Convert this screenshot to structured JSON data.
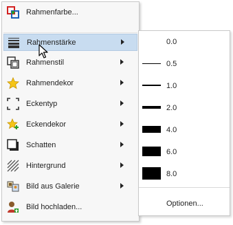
{
  "menu": {
    "items": [
      {
        "label": "Rahmenfarbe...",
        "icon": "frame-color-icon",
        "submenu": false
      },
      {
        "label": "Rahmenstärke",
        "icon": "line-weight-icon",
        "submenu": true
      },
      {
        "label": "Rahmenstil",
        "icon": "frame-style-icon",
        "submenu": true
      },
      {
        "label": "Rahmendekor",
        "icon": "star-icon",
        "submenu": true
      },
      {
        "label": "Eckentyp",
        "icon": "corner-type-icon",
        "submenu": true
      },
      {
        "label": "Eckendekor",
        "icon": "star-plus-icon",
        "submenu": true
      },
      {
        "label": "Schatten",
        "icon": "shadow-icon",
        "submenu": true
      },
      {
        "label": "Hintergrund",
        "icon": "hatch-icon",
        "submenu": true
      },
      {
        "label": "Bild aus Galerie",
        "icon": "gallery-icon",
        "submenu": true
      },
      {
        "label": "Bild hochladen...",
        "icon": "upload-user-icon",
        "submenu": false
      }
    ],
    "highlighted_index": 1
  },
  "submenu": {
    "options": [
      {
        "value": "0.0"
      },
      {
        "value": "0.5"
      },
      {
        "value": "1.0"
      },
      {
        "value": "2.0"
      },
      {
        "value": "4.0"
      },
      {
        "value": "6.0"
      },
      {
        "value": "8.0"
      }
    ],
    "footer": "Optionen..."
  },
  "colors": {
    "highlight": "#c8dcf0",
    "menu_background": "#f7f7f7"
  }
}
